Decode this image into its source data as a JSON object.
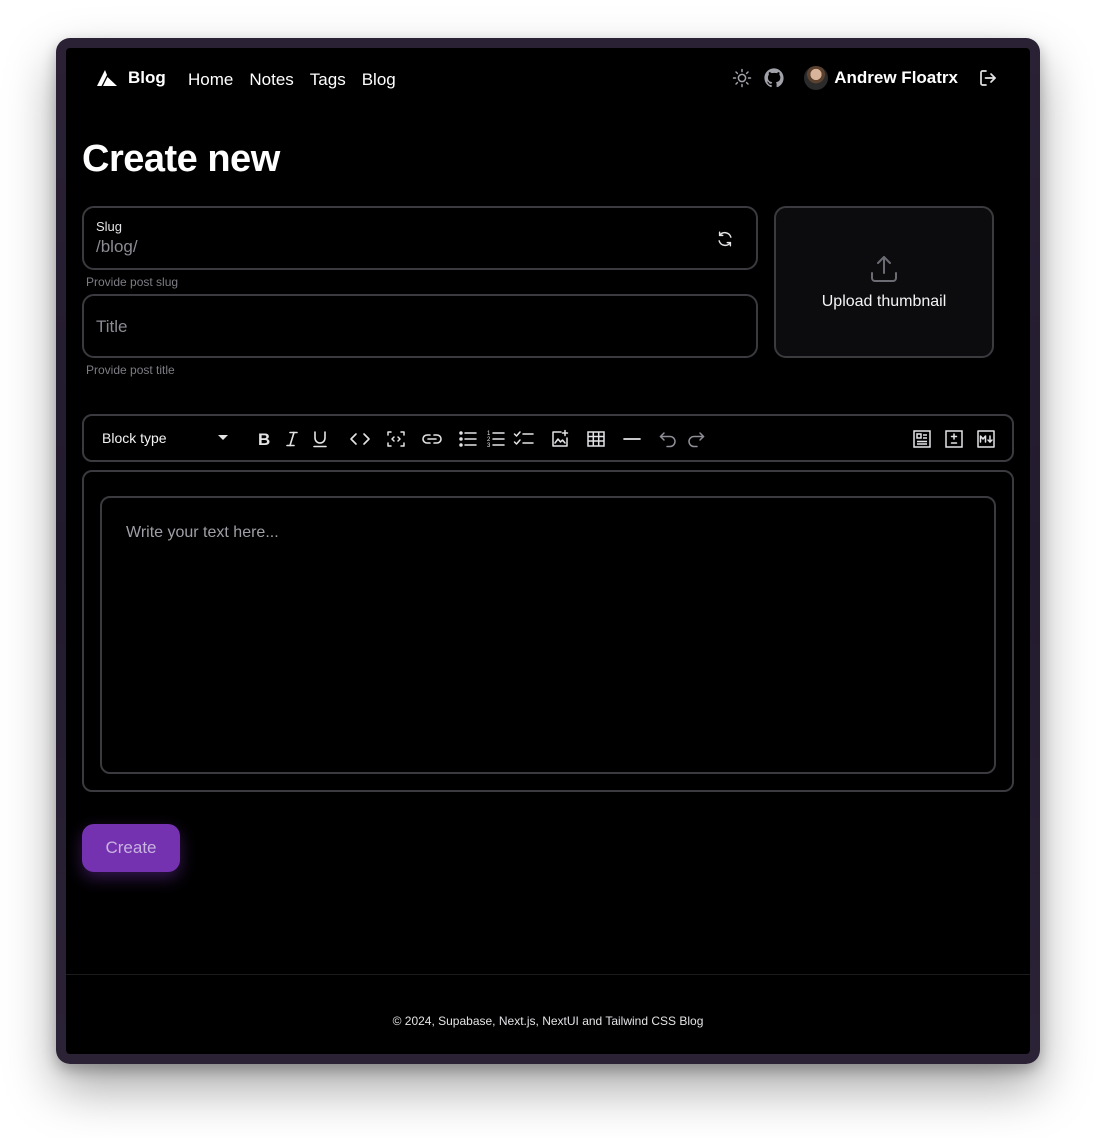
{
  "nav": {
    "brand_label": "Blog",
    "links": [
      "Home",
      "Notes",
      "Tags",
      "Blog"
    ],
    "user_name": "Andrew Floatrx"
  },
  "page": {
    "title": "Create new"
  },
  "form": {
    "slug": {
      "label": "Slug",
      "value": "/blog/",
      "helper": "Provide post slug"
    },
    "title": {
      "placeholder": "Title",
      "helper": "Provide post title"
    },
    "upload_label": "Upload thumbnail"
  },
  "editor": {
    "block_type_label": "Block type",
    "placeholder": "Write your text here...",
    "toolbar_icons": [
      "bold-icon",
      "italic-icon",
      "underline-icon",
      "code-icon",
      "code-block-icon",
      "link-icon",
      "bullet-list-icon",
      "numbered-list-icon",
      "checklist-icon",
      "insert-image-icon",
      "table-icon",
      "horizontal-rule-icon",
      "undo-icon",
      "redo-icon",
      "rich-text-icon",
      "diff-icon",
      "markdown-icon"
    ]
  },
  "actions": {
    "create_label": "Create"
  },
  "footer": {
    "text": "© 2024, Supabase, Next.js, NextUI and Tailwind CSS Blog"
  },
  "colors": {
    "accent": "#7432b0",
    "background": "#000000",
    "border": "#3a3a3f"
  }
}
